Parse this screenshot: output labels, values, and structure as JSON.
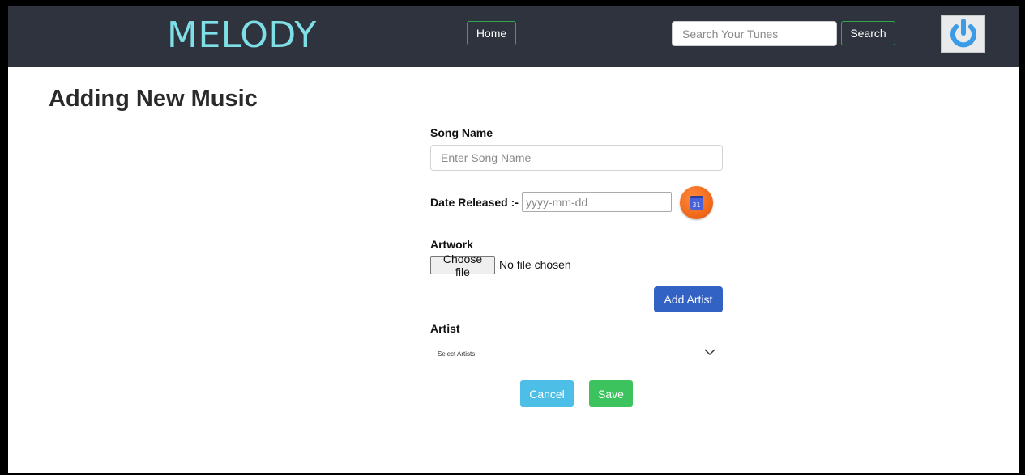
{
  "nav": {
    "brand": "MELODY",
    "home_label": "Home",
    "search_placeholder": "Search Your Tunes",
    "search_label": "Search",
    "power_icon": "power-icon"
  },
  "page": {
    "title": "Adding New Music"
  },
  "form": {
    "song_name_label": "Song Name",
    "song_name_placeholder": "Enter Song Name",
    "date_label": "Date Released :-",
    "date_placeholder": "yyyy-mm-dd",
    "calendar_day": "31",
    "artwork_label": "Artwork",
    "choose_file_label": "Choose file",
    "file_status": "No file chosen",
    "add_artist_label": "Add Artist",
    "artist_label": "Artist",
    "artist_select_value": "Select Artists",
    "cancel_label": "Cancel",
    "save_label": "Save"
  },
  "colors": {
    "navbar_bg": "#2f333d",
    "brand": "#7fdfe6",
    "nav_border": "#2fa84f",
    "add_artist": "#3162c4",
    "cancel": "#4dbfe6",
    "save": "#3cc35e",
    "calendar_button": "#f26a1b",
    "power_icon": "#3b9be6"
  }
}
